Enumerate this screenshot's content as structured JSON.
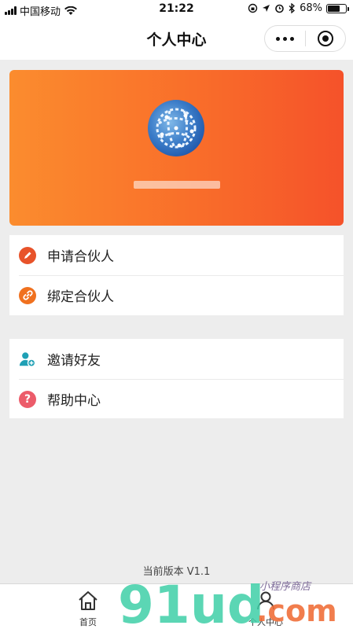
{
  "status_bar": {
    "carrier": "中国移动",
    "time": "21:22",
    "battery": "68%",
    "battery_level": 0.68
  },
  "nav": {
    "title": "个人中心",
    "more_icon": "more-dots-icon",
    "close_icon": "target-close-icon"
  },
  "menu_group_1": [
    {
      "label": "申请合伙人",
      "icon": "pen-icon",
      "color": "#e8532a"
    },
    {
      "label": "绑定合伙人",
      "icon": "link-icon",
      "color": "#f0711f"
    }
  ],
  "menu_group_2": [
    {
      "label": "邀请好友",
      "icon": "add-user-icon",
      "color": "#1fa0b5"
    },
    {
      "label": "帮助中心",
      "icon": "help-icon",
      "color": "#ec5c6a"
    }
  ],
  "version": "当前版本 V1.1",
  "tabbar": {
    "tabs": [
      {
        "label": "首页",
        "icon": "home-icon"
      },
      {
        "label": "个人中心",
        "icon": "user-icon"
      }
    ]
  },
  "watermark": {
    "text_large": "91ud.com",
    "text_small": "小程序商店"
  },
  "colors": {
    "banner_start": "#fb8c2e",
    "banner_end": "#f5522a",
    "background": "#ededed"
  }
}
